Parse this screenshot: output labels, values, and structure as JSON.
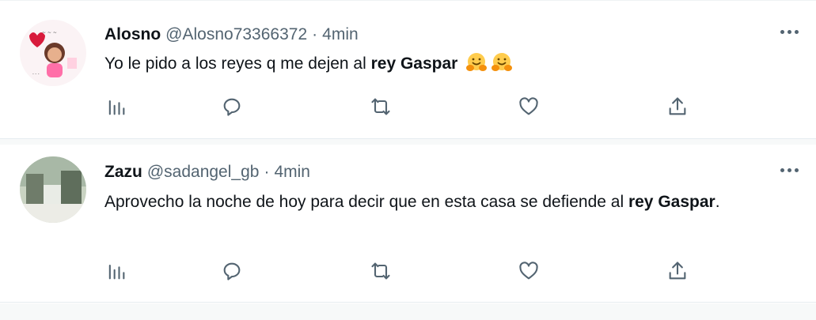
{
  "tweets": [
    {
      "name": "Alosno",
      "handle": "@Alosno73366372",
      "separator": "·",
      "time": "4min",
      "text_plain": "Yo le pido a los reyes q me dejen al ",
      "text_bold": "rey Gaspar",
      "text_after": "",
      "emojis": [
        "hugging-face-emoji",
        "hugging-face-emoji"
      ]
    },
    {
      "name": "Zazu",
      "handle": "@sadangel_gb",
      "separator": "·",
      "time": "4min",
      "text_plain": "Aprovecho la noche de hoy para decir que en esta casa se defiende al ",
      "text_bold": "rey Gaspar",
      "text_after": ".",
      "emojis": []
    }
  ],
  "icons": {
    "views": "bar-chart-icon",
    "reply": "speech-bubble-icon",
    "retweet": "retweet-icon",
    "like": "heart-icon",
    "share": "share-upload-icon",
    "more": "more-dots-icon"
  },
  "colors": {
    "text": "#0f1419",
    "secondary": "#536471",
    "divider": "#e6ecf0"
  }
}
